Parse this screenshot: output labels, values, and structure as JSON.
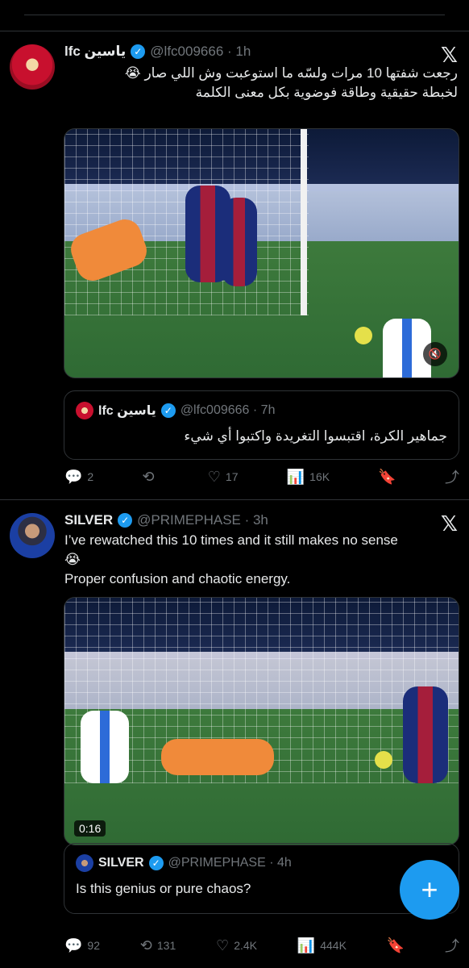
{
  "tweets": [
    {
      "author_name": "lfc ياسين",
      "verified_mark": "✓",
      "handle_time": "@lfc009666 · 1h",
      "logo": "𝕏",
      "text_line1": "رجعت شفتها 10 مرات ولسّه ما استوعبت وش اللي صار 😭",
      "text_line2": "لخبطة حقيقية وطاقة فوضوية بكل معنى الكلمة",
      "media": {
        "mute_icon": "🔇"
      },
      "quote": {
        "author_name": "lfc ياسين",
        "handle_time": "@lfc009666 · 7h",
        "text": "جماهير الكرة، اقتبسوا التغريدة واكتبوا أي شيء"
      },
      "actions": {
        "replies": "2",
        "reposts": "",
        "likes": "17",
        "views": "16K"
      }
    },
    {
      "author_name": "SILVER",
      "verified_mark": "✓",
      "handle_time": "@PRIMEPHASE · 3h",
      "logo": "𝕏",
      "text_line1": "I’ve rewatched this 10 times and it still makes no sense",
      "text_line2": "😭",
      "text_line3": "Proper confusion and chaotic energy.",
      "media": {
        "duration": "0:16"
      },
      "quote": {
        "author_name": "SILVER",
        "handle_time": "@PRIMEPHASE · 4h",
        "text": "Is this genius or pure chaos?"
      },
      "actions": {
        "replies": "92",
        "reposts": "131",
        "likes": "2.4K",
        "views": "444K"
      }
    }
  ],
  "fab": {
    "label": "+"
  }
}
